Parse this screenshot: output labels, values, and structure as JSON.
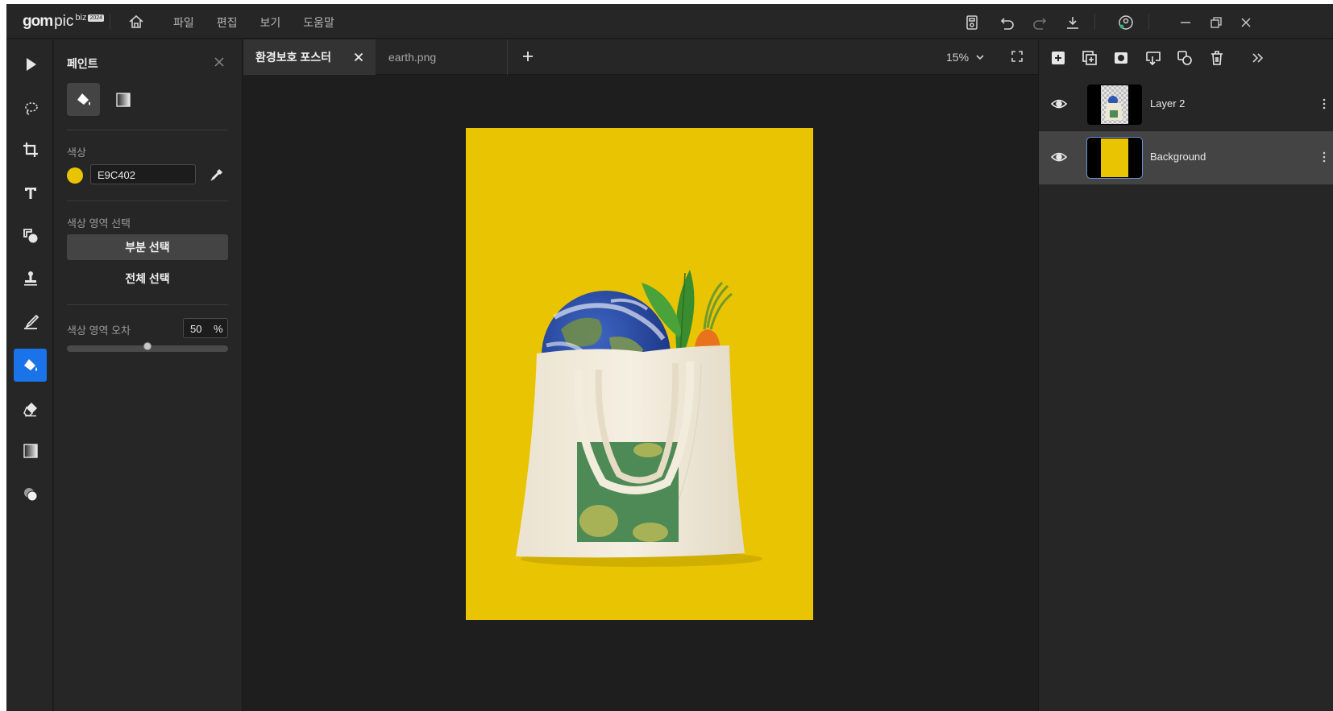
{
  "app": {
    "logo": {
      "gom": "gom",
      "pic": "pic",
      "biz": "biz",
      "badge": "2024"
    },
    "menu": [
      "파일",
      "편집",
      "보기",
      "도움말"
    ]
  },
  "paint_panel": {
    "title": "페인트",
    "color_label": "색상",
    "color_hex": "E9C402",
    "color_swatch": "#E9C402",
    "region_label": "색상 영역 선택",
    "partial_select": "부분 선택",
    "all_select": "전체 선택",
    "tolerance_label": "색상 영역 오차",
    "tolerance_value": "50",
    "tolerance_unit": "%",
    "tolerance_fraction": 0.5
  },
  "tabs": [
    {
      "label": "환경보호 포스터",
      "active": true
    },
    {
      "label": "earth.png",
      "active": false
    }
  ],
  "zoom": "15%",
  "canvas": {
    "background": "#E9C402"
  },
  "layers": [
    {
      "name": "Layer 2",
      "selected": false,
      "thumb": "bag-icon"
    },
    {
      "name": "Background",
      "selected": true,
      "thumb": "yellow-fill"
    }
  ],
  "colors": {
    "accent": "#1a73e8",
    "panel": "#262626",
    "canvas_bg": "#1e1e1e"
  }
}
